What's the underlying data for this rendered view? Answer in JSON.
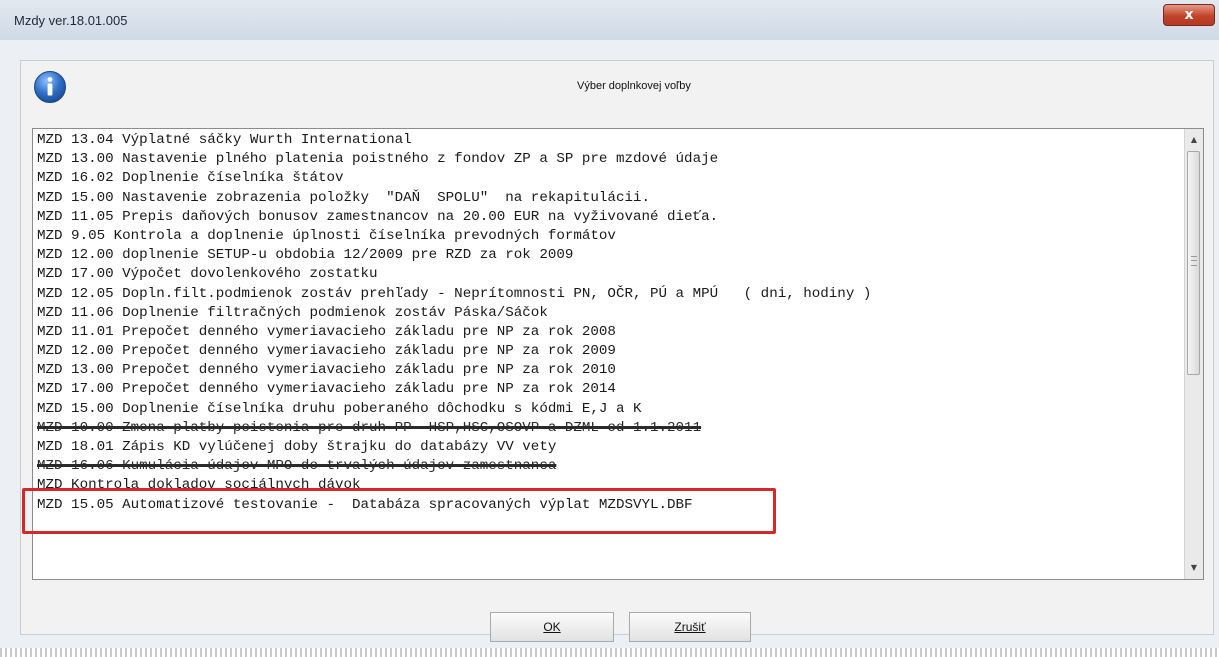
{
  "window": {
    "title": "Mzdy ver.18.01.005",
    "close_glyph": "x"
  },
  "dialog": {
    "icon": "info-icon",
    "heading": "Výber doplnkovej voľby"
  },
  "list": {
    "items": [
      "MZD 13.04 Výplatné sáčky Wurth International",
      "MZD 13.00 Nastavenie plného platenia poistného z fondov ZP a SP pre mzdové údaje",
      "MZD 16.02 Doplnenie číselníka štátov",
      "MZD 15.00 Nastavenie zobrazenia položky  \"DAŇ  SPOLU\"  na rekapitulácii.",
      "MZD 11.05 Prepis daňových bonusov zamestnancov na 20.00 EUR na vyživované dieťa.",
      "MZD 9.05 Kontrola a doplnenie úplnosti číselníka prevodných formátov",
      "MZD 12.00 doplnenie SETUP-u obdobia 12/2009 pre RZD za rok 2009",
      "MZD 17.00 Výpočet dovolenkového zostatku",
      "MZD 12.05 Dopln.filt.podmienok zostáv prehľady - Neprítomnosti PN, OČR, PÚ a MPÚ   ( dni, hodiny )",
      "MZD 11.06 Doplnenie filtračných podmienok zostáv Páska/Sáčok",
      "MZD 11.01 Prepočet denného vymeriavacieho základu pre NP za rok 2008",
      "MZD 12.00 Prepočet denného vymeriavacieho základu pre NP za rok 2009",
      "MZD 13.00 Prepočet denného vymeriavacieho základu pre NP za rok 2010",
      "MZD 17.00 Prepočet denného vymeriavacieho základu pre NP za rok 2014",
      "MZD 15.00 Doplnenie číselníka druhu poberaného dôchodku s kódmi E,J a K",
      "MZD 10.00 Zmena platby poistenia pre druh PP  HSP,HSC,OSOVP a DZML od 1.1.2011",
      "MZD 18.01 Zápis KD vylúčenej doby štrajku do databázy VV vety",
      "MZD 16.06 Kumulácia údajov MPO do trvalých údajov zamestnanca",
      "MZD Kontrola dokladov sociálnych dávok",
      "MZD 15.05 Automatizové testovanie -  Databáza spracovaných výplat MZDSVYL.DBF"
    ]
  },
  "buttons": {
    "ok": "OK",
    "cancel": "Zrušiť"
  },
  "colors": {
    "highlight": "#d62828",
    "info_icon": "#2f6fc4"
  }
}
